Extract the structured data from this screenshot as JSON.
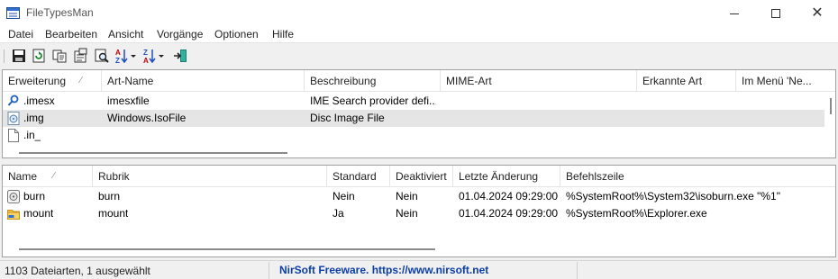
{
  "window": {
    "title": "FileTypesMan"
  },
  "menu": [
    "Datei",
    "Bearbeiten",
    "Ansicht",
    "Vorgänge",
    "Optionen",
    "Hilfe"
  ],
  "toolbar": {
    "buttons": [
      "save-icon",
      "refresh-icon",
      "copy-icon",
      "properties-icon",
      "find-icon",
      "sort-ascending-icon",
      "sort-descending-icon",
      "exit-icon"
    ]
  },
  "top_list": {
    "columns": [
      "Erweiterung",
      "Art-Name",
      "Beschreibung",
      "MIME-Art",
      "Erkannte Art",
      "Im Menü 'Ne..."
    ],
    "rows": [
      {
        "icon": "search-provider-icon",
        "ext": ".imesx",
        "name": "imesxfile",
        "desc": "IME Search provider defi...",
        "mime": "",
        "perceived": "",
        "new": "",
        "selected": false
      },
      {
        "icon": "disc-image-icon",
        "ext": ".img",
        "name": "Windows.IsoFile",
        "desc": "Disc Image File",
        "mime": "",
        "perceived": "",
        "new": "",
        "selected": true
      },
      {
        "icon": "blank-file-icon",
        "ext": ".in_",
        "name": "",
        "desc": "",
        "mime": "",
        "perceived": "",
        "new": "",
        "selected": false
      }
    ]
  },
  "bottom_list": {
    "columns": [
      "Name",
      "Rubrik",
      "Standard",
      "Deaktiviert",
      "Letzte Änderung",
      "Befehlszeile"
    ],
    "rows": [
      {
        "icon": "disc-burn-icon",
        "name": "burn",
        "rubrik": "burn",
        "standard": "Nein",
        "deaktiviert": "Nein",
        "changed": "01.04.2024 09:29:00",
        "command": "%SystemRoot%\\System32\\isoburn.exe \"%1\""
      },
      {
        "icon": "folder-icon",
        "name": "mount",
        "rubrik": "mount",
        "standard": "Ja",
        "deaktiviert": "Nein",
        "changed": "01.04.2024 09:29:00",
        "command": "%SystemRoot%\\Explorer.exe"
      }
    ]
  },
  "status": {
    "count_text": "1103 Dateiarten, 1 ausgewählt",
    "link_text": "NirSoft Freeware. https://www.nirsoft.net"
  }
}
